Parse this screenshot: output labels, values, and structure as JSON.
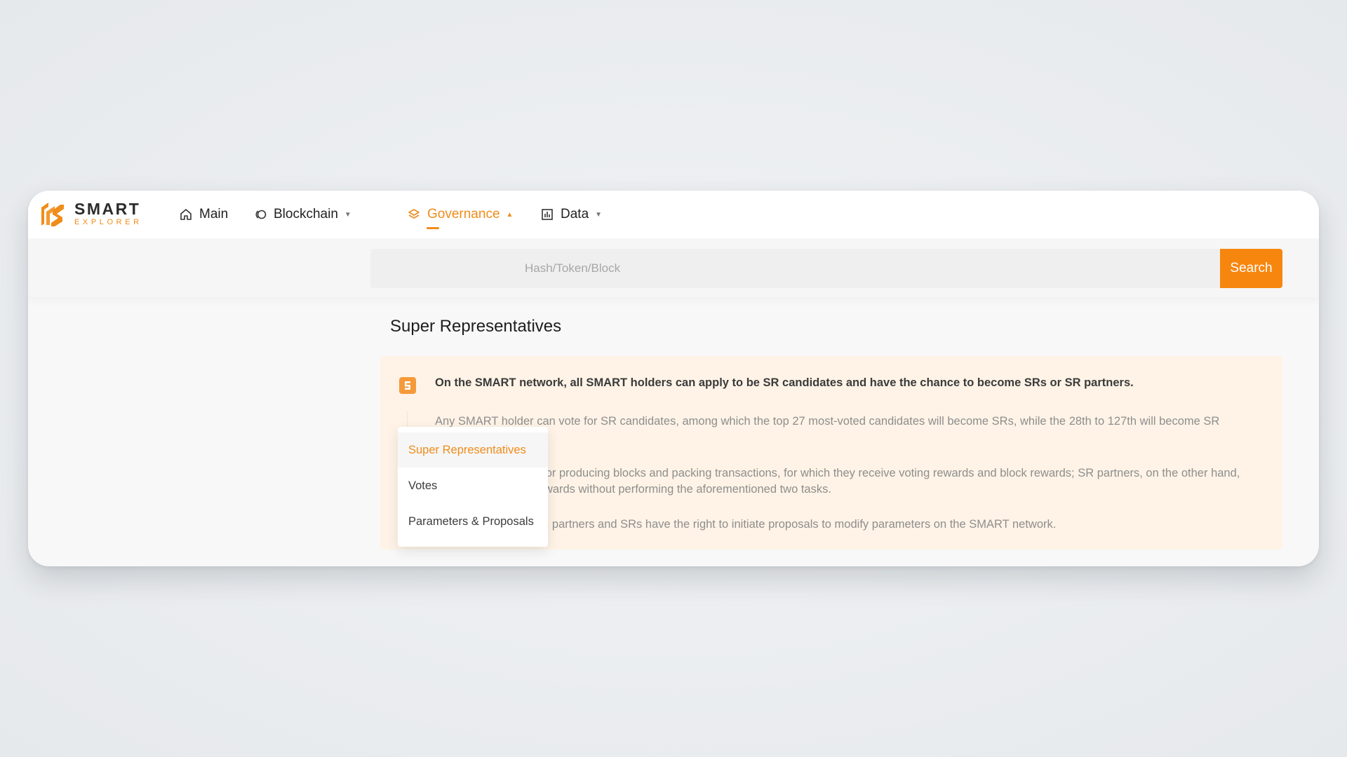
{
  "brand": {
    "name": "SMART",
    "subtitle": "EXPLORER",
    "accent_color": "#f08c1a",
    "button_color": "#f7860f"
  },
  "nav": {
    "items": [
      {
        "label": "Main",
        "icon": "home-icon",
        "active": false,
        "has_caret": false
      },
      {
        "label": "Blockchain",
        "icon": "blockchain-icon",
        "active": false,
        "has_caret": true
      },
      {
        "label": "Governance",
        "icon": "layers-icon",
        "active": true,
        "has_caret": true
      },
      {
        "label": "Data",
        "icon": "chart-icon",
        "active": false,
        "has_caret": true
      }
    ]
  },
  "governance_menu": {
    "items": [
      {
        "label": "Super Representatives",
        "selected": true
      },
      {
        "label": "Votes",
        "selected": false
      },
      {
        "label": "Parameters & Proposals",
        "selected": false
      }
    ]
  },
  "search": {
    "placeholder": "Hash/Token/Block",
    "button_label": "Search"
  },
  "page": {
    "title": "Super Representatives"
  },
  "info": {
    "icon": "smart-badge-icon",
    "headline": "On the SMART network, all SMART holders can apply to be SR candidates and have the chance to become SRs or SR partners.",
    "paragraphs": [
      "Any SMART holder can vote for SR candidates, among which the top 27 most-voted candidates will become SRs, while the 28th to 127th will become SR partners.",
      "SRs are responsible for producing blocks and packing transactions, for which they receive voting rewards and block rewards; SR partners, on the other hand, only receive voting rewards without performing the aforementioned two tasks.",
      "All SR candidates, SR partners and SRs have the right to initiate proposals to modify parameters on the SMART network."
    ]
  }
}
